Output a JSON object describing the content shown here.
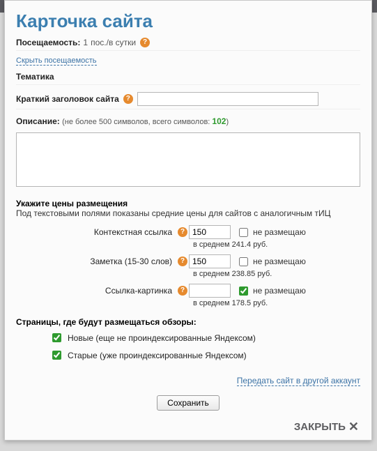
{
  "header": {
    "title": "Карточка сайта"
  },
  "traffic": {
    "label": "Посещаемость:",
    "value": "1",
    "unit": "пос./в сутки",
    "hide_link": "Скрыть посещаемость"
  },
  "theme": {
    "label": "Тематика"
  },
  "short_title": {
    "label": "Краткий заголовок сайта",
    "value": ""
  },
  "description": {
    "label": "Описание:",
    "hint_prefix": "(не более 500 символов, всего символов: ",
    "count": "102",
    "hint_suffix": ")",
    "value": ""
  },
  "prices": {
    "heading": "Укажите цены размещения",
    "subheading": "Под текстовыми полями показаны средние цены для сайтов с аналогичным тИЦ",
    "rows": [
      {
        "label": "Контекстная ссылка",
        "value": "150",
        "no_place": "не размещаю",
        "avg": "в среднем 241.4 руб.",
        "checked": false
      },
      {
        "label": "Заметка (15-30 слов)",
        "value": "150",
        "no_place": "не размещаю",
        "avg": "в среднем 238.85 руб.",
        "checked": false
      },
      {
        "label": "Ссылка-картинка",
        "value": "",
        "no_place": "не размещаю",
        "avg": "в среднем 178.5 руб.",
        "checked": true
      }
    ]
  },
  "pages": {
    "heading": "Страницы, где будут размещаться обзоры:",
    "options": [
      {
        "label": "Новые (еще не проиндексированные Яндексом)",
        "checked": true
      },
      {
        "label": "Старые (уже проиндексированные Яндексом)",
        "checked": true
      }
    ]
  },
  "transfer": {
    "link": "Передать сайт в другой аккаунт"
  },
  "actions": {
    "save": "Сохранить",
    "close": "ЗАКРЫТЬ"
  }
}
